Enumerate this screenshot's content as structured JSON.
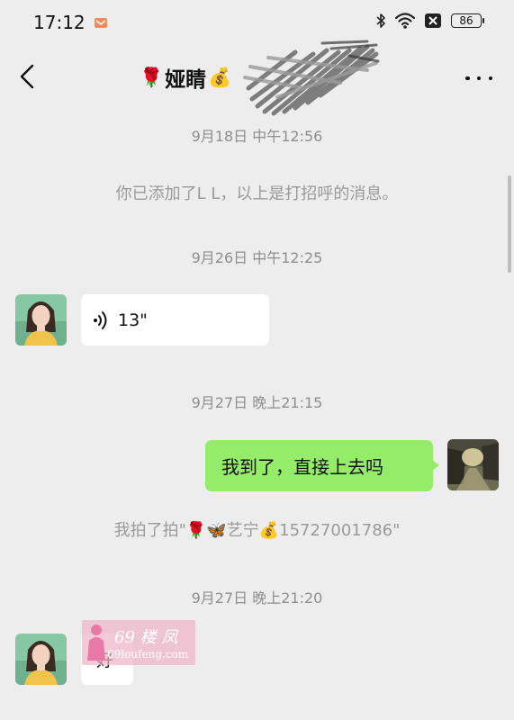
{
  "status_bar": {
    "time": "17:12",
    "battery": "86",
    "icons": [
      "app-notification-icon",
      "bluetooth-icon",
      "wifi-icon",
      "no-sim-icon",
      "battery-icon"
    ]
  },
  "header": {
    "title_prefix_emoji": "🌹",
    "title": "娅睛",
    "title_suffix_emoji": "💰",
    "back_icon": "chevron-left-icon",
    "more_icon": "more-dots-icon"
  },
  "messages": [
    {
      "type": "timestamp",
      "text": "9月18日 中午12:56"
    },
    {
      "type": "system",
      "text": "你已添加了L L，以上是打招呼的消息。"
    },
    {
      "type": "timestamp",
      "text": "9月26日 中午12:25"
    },
    {
      "type": "voice_in",
      "duration": "13\"",
      "icon": "voice-wave-icon"
    },
    {
      "type": "timestamp",
      "text": "9月27日 晚上21:15"
    },
    {
      "type": "text_out",
      "text": "我到了，直接上去吗"
    },
    {
      "type": "system",
      "text": "我拍了拍\"🌹🦋艺宁💰15727001786\""
    },
    {
      "type": "timestamp",
      "text": "9月27日 晚上21:20"
    },
    {
      "type": "text_in",
      "text": "好"
    }
  ],
  "watermark": {
    "line1": "69 楼 凤",
    "line2": "69loufeng.com"
  },
  "colors": {
    "background": "#ededed",
    "outgoing_bubble": "#95ec69",
    "incoming_bubble": "#ffffff",
    "timestamp_text": "#8e8e8e"
  }
}
